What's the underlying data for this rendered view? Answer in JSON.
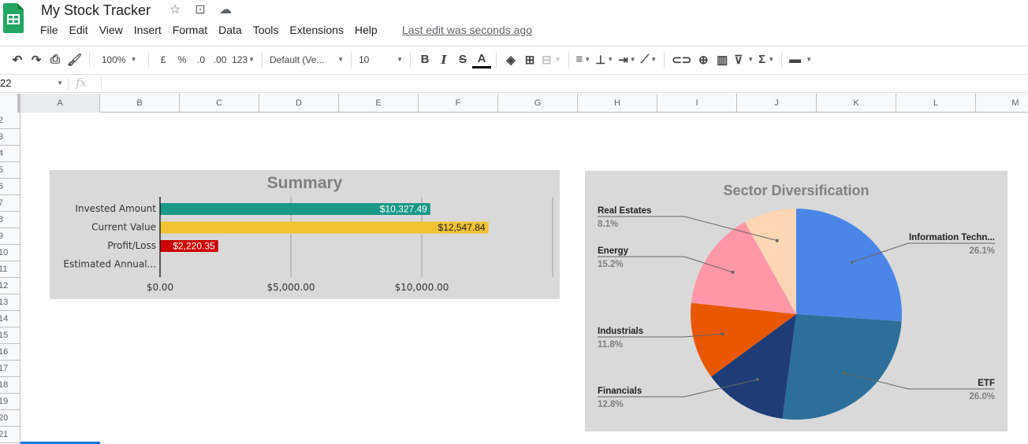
{
  "app": {
    "title": "My Stock Tracker",
    "title_icons": [
      "star-icon",
      "move-to-folder-icon",
      "cloud-status-icon"
    ],
    "menu": [
      "File",
      "Edit",
      "View",
      "Insert",
      "Format",
      "Data",
      "Tools",
      "Extensions",
      "Help"
    ],
    "last_edit": "Last edit was seconds ago"
  },
  "toolbar": {
    "zoom": "100%",
    "currency": "£",
    "percent": "%",
    "decrease_decimal": ".0",
    "increase_decimal": ".00",
    "number_format": "123",
    "font": "Default (Ve...",
    "font_size": "10",
    "bold": "B",
    "italic": "I",
    "strikethrough": "S",
    "text_color": "A"
  },
  "formula_bar": {
    "name_box": "22",
    "fx": "fx",
    "value": ""
  },
  "grid": {
    "columns": [
      "A",
      "B",
      "C",
      "D",
      "E",
      "F",
      "G",
      "H",
      "I",
      "J",
      "K",
      "L",
      "M"
    ],
    "rows": [
      "2",
      "3",
      "4",
      "5",
      "6",
      "7",
      "8",
      "9",
      "10",
      "11",
      "12",
      "13",
      "14",
      "15",
      "16",
      "17",
      "18",
      "19",
      "20",
      "21"
    ]
  },
  "chart_data": [
    {
      "type": "bar",
      "title": "Summary",
      "categories": [
        "Invested Amount",
        "Current Value",
        "Profit/Loss",
        "Estimated Annual..."
      ],
      "values": [
        10327.49,
        12547.84,
        2220.35,
        0
      ],
      "labels": [
        "$10,327.49",
        "$12,547.84",
        "$2,220.35",
        ""
      ],
      "colors": [
        "#1a9988",
        "#f1c232",
        "#cc0000",
        "#cc0000"
      ],
      "label_colors": [
        "#ffffff",
        "#202124",
        "#ffffff",
        "#ffffff"
      ],
      "xticks": [
        0,
        5000,
        10000,
        15000
      ],
      "xtick_labels": [
        "$0.00",
        "$5,000.00",
        "$10,000.00",
        ""
      ],
      "xlim": [
        0,
        15000
      ],
      "orientation": "horizontal",
      "grid": true,
      "background": "#d9d9d9"
    },
    {
      "type": "pie",
      "title": "Sector Diversification",
      "slices": [
        {
          "label": "Information Techn...",
          "value": 26.1,
          "pct": "26.1%",
          "color": "#4a86e8"
        },
        {
          "label": "ETF",
          "value": 26.0,
          "pct": "26.0%",
          "color": "#2c6f9a"
        },
        {
          "label": "Financials",
          "value": 12.8,
          "pct": "12.8%",
          "color": "#1f3c77"
        },
        {
          "label": "Industrials",
          "value": 11.8,
          "pct": "11.8%",
          "color": "#e85800"
        },
        {
          "label": "Energy",
          "value": 15.2,
          "pct": "15.2%",
          "color": "#ff97a8"
        },
        {
          "label": "Real Estates",
          "value": 8.1,
          "pct": "8.1%",
          "color": "#ffd5b5"
        }
      ],
      "legend": "labeled",
      "background": "#d9d9d9"
    }
  ]
}
